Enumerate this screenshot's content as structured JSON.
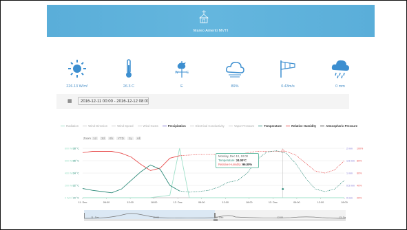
{
  "header": {
    "title": "Mareo Ameriti MVTI",
    "logo_icon": "house-weathervane-icon",
    "background": "#5aaed9"
  },
  "stats": [
    {
      "icon": "sun-icon",
      "value": "226.13 W/m²"
    },
    {
      "icon": "thermometer-icon",
      "value": "26.3 C"
    },
    {
      "icon": "rooster-weathervane-icon",
      "value": "E"
    },
    {
      "icon": "cloud-icon",
      "value": "89%"
    },
    {
      "icon": "windsock-icon",
      "value": "0.43m/s"
    },
    {
      "icon": "rain-cloud-icon",
      "value": "0 mm"
    }
  ],
  "date_range": {
    "icon": "calendar-icon",
    "value": "2016-12-11 00:00 - 2016-12-12 08:00"
  },
  "legend": [
    {
      "label": "Radiation",
      "color": "#9fe0c9",
      "active": false
    },
    {
      "label": "Wind Direction",
      "color": "#cccccc",
      "active": false
    },
    {
      "label": "Wind Speed",
      "color": "#cccccc",
      "active": false
    },
    {
      "label": "Wind Gusts",
      "color": "#cccccc",
      "active": false
    },
    {
      "label": "Precipitation",
      "color": "#7b6fd0",
      "active": true
    },
    {
      "label": "Electrical Conductivity",
      "color": "#cccccc",
      "active": false
    },
    {
      "label": "Vapor Pressure",
      "color": "#cccccc",
      "active": false
    },
    {
      "label": "Temperature",
      "color": "#2e8b7a",
      "active": true
    },
    {
      "label": "Relative Humidity",
      "color": "#e85050",
      "active": true
    },
    {
      "label": "Atmospheric Pressure",
      "color": "#333333",
      "active": true
    }
  ],
  "zoom": {
    "label": "Zoom",
    "options": [
      "1d",
      "3d",
      "6h",
      "YTD",
      "1y",
      "All"
    ]
  },
  "tooltip": {
    "title": "Monday, Dec 12, 10:00",
    "temp_label": "Temperature:",
    "temp_value": "24.00°C",
    "rh_label": "Relative Humidity:",
    "rh_value": "96.00%"
  },
  "chart_data": {
    "type": "line",
    "x_ticks": [
      "11. Dec",
      "06:00",
      "12:00",
      "18:00",
      "12. Dec",
      "06:00",
      "12:00",
      "18:00",
      "13. Dec",
      "06:00",
      "12:00",
      "18:00"
    ],
    "left_axis_radiation": [
      "0 W/m²",
      "200 W/m²",
      "400 W/m²",
      "600 W/m²",
      "800 W/m²"
    ],
    "left_axis_temp": [
      "20 °C",
      "22 °C",
      "24 °C",
      "26 °C",
      "28 °C"
    ],
    "right_axis_precip": [
      "0 mm",
      "0.5 mm",
      "1 mm",
      "1.5 mm",
      "2 mm"
    ],
    "right_axis_rh": [
      "20%",
      "40%",
      "60%",
      "80%",
      "100%"
    ],
    "series": [
      {
        "name": "Temperature",
        "color": "#2e8b7a",
        "forecast_from": 10,
        "values": [
          21.5,
          21.2,
          21.0,
          20.8,
          21.4,
          22.8,
          24.2,
          25.3,
          24.6,
          22.0,
          21.1,
          20.9,
          21.0,
          21.2,
          21.7,
          22.5,
          22.8,
          24.0,
          26.2,
          27.4,
          27.6,
          27.2,
          25.5,
          23.2,
          21.4,
          21.0,
          21.4,
          22.8
        ]
      },
      {
        "name": "Relative Humidity",
        "color": "#e85050",
        "forecast_from": 10,
        "values": [
          93,
          95,
          95,
          95,
          92,
          86,
          74,
          64,
          68,
          84,
          88,
          89,
          90,
          90,
          90,
          90,
          88,
          93,
          95,
          95,
          95,
          95,
          89,
          76,
          63,
          60,
          65,
          80
        ]
      },
      {
        "name": "Radiation",
        "color": "#9fe0c9",
        "values": [
          0,
          0,
          0,
          0,
          0,
          0,
          0,
          2,
          20,
          40,
          800,
          0,
          0,
          0,
          0,
          0,
          0,
          0,
          0,
          0,
          0,
          0,
          0,
          0,
          0,
          0,
          0,
          0
        ]
      }
    ],
    "marker_label": "12:00"
  },
  "navigator": {
    "labels": [
      "11. Dec",
      "10:00",
      "12. Dec",
      "12:00",
      "13. Dec"
    ]
  }
}
